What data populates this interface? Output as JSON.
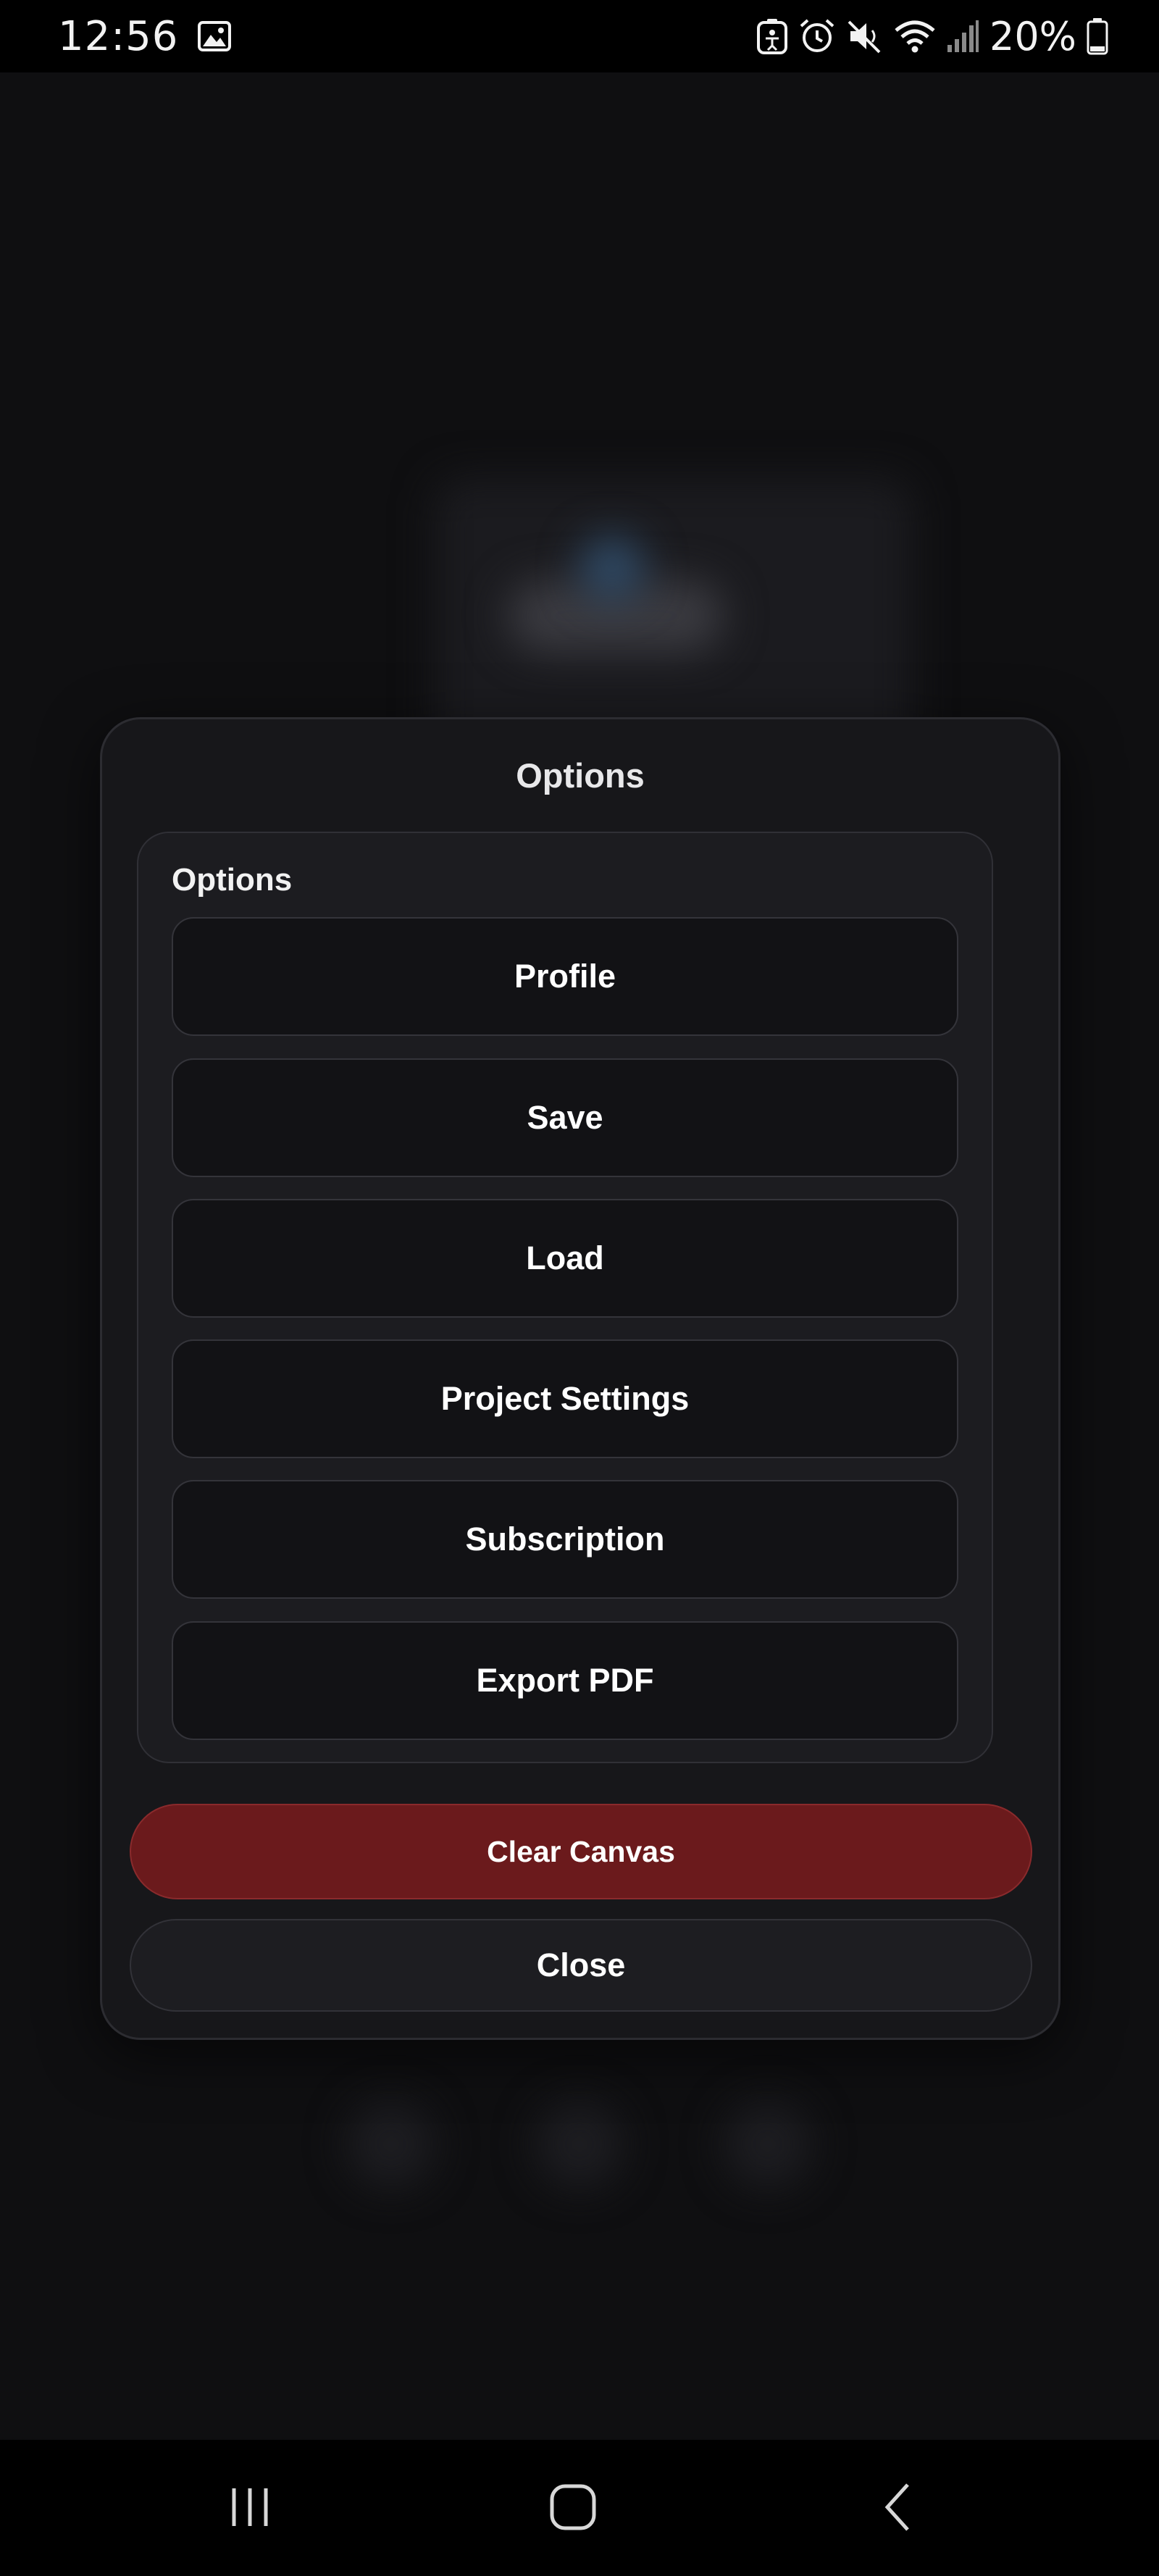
{
  "status_bar": {
    "time": "12:56",
    "battery_percent": "20%",
    "icons": [
      "image-icon",
      "accessibility-icon",
      "alarm-icon",
      "mute-icon",
      "wifi-icon",
      "signal-icon",
      "battery-icon"
    ]
  },
  "dialog": {
    "title": "Options",
    "panel_heading": "Options",
    "options": [
      {
        "label": "Profile"
      },
      {
        "label": "Save"
      },
      {
        "label": "Load"
      },
      {
        "label": "Project Settings"
      },
      {
        "label": "Subscription"
      },
      {
        "label": "Export PDF"
      }
    ],
    "clear_label": "Clear Canvas",
    "close_label": "Close"
  },
  "colors": {
    "background": "#0f0f11",
    "dialog": "#17171a",
    "danger": "#6b1a1c",
    "text": "#ffffff"
  },
  "nav_bar": {
    "icons": [
      "recent-apps-icon",
      "home-icon",
      "back-icon"
    ]
  }
}
